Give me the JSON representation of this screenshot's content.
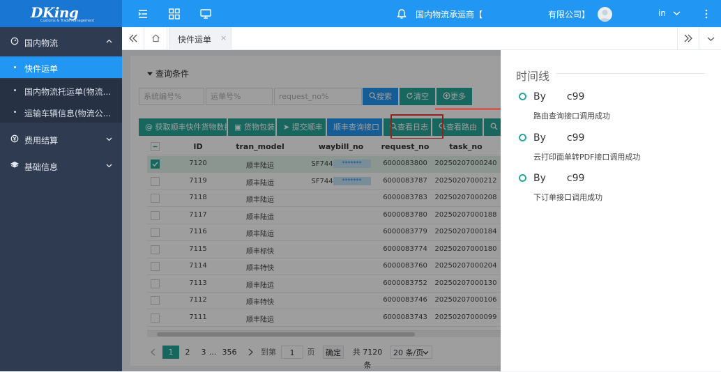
{
  "header": {
    "logo": "DKing",
    "logo_subtitle": "Customs & Trade Management",
    "company_left": "国内物流承运商【",
    "company_right": "有限公司】",
    "lang": "in"
  },
  "sidebar": {
    "groups": [
      {
        "label": "国内物流"
      },
      {
        "label": "费用结算"
      },
      {
        "label": "基础信息"
      }
    ],
    "items": [
      {
        "label": "快件运单"
      },
      {
        "label": "国内物流托运单(物流..."
      },
      {
        "label": "运输车辆信息(物流公..."
      }
    ]
  },
  "tabs": {
    "active_label": "快件运单",
    "close_glyph": "×"
  },
  "query": {
    "title": "查询条件",
    "inputs": [
      {
        "placeholder": "系统编号%"
      },
      {
        "placeholder": "运单号%"
      },
      {
        "placeholder": "request_no%"
      }
    ],
    "buttons": {
      "search": "搜索",
      "clear": "清空",
      "more": "更多"
    }
  },
  "toolbar": {
    "get_data": "获取顺丰快件货物数据",
    "package": "货物包装",
    "submit_sf": "提交顺丰",
    "sf_query_api": "顺丰查询接口",
    "view_log": "查看日志",
    "view_route": "查看路由"
  },
  "table": {
    "columns": [
      "ID",
      "tran_model",
      "waybill_no",
      "request_no",
      "task_no"
    ],
    "rows": [
      {
        "id": "7120",
        "tran_model": "顺丰陆运",
        "waybill_prefix": "SF744",
        "waybill_mask": "*******",
        "request_no": "6000083800",
        "task_no": "20250207000240",
        "selected": true
      },
      {
        "id": "7119",
        "tran_model": "顺丰陆运",
        "waybill_prefix": "SF744",
        "waybill_mask": "*******",
        "request_no": "6000083787",
        "task_no": "20250207000212",
        "selected": false
      },
      {
        "id": "7118",
        "tran_model": "顺丰陆运",
        "waybill_prefix": "",
        "waybill_mask": "",
        "request_no": "6000083783",
        "task_no": "20250207000208",
        "selected": false
      },
      {
        "id": "7117",
        "tran_model": "顺丰陆运",
        "waybill_prefix": "",
        "waybill_mask": "",
        "request_no": "6000083780",
        "task_no": "20250207000188",
        "selected": false
      },
      {
        "id": "7116",
        "tran_model": "顺丰陆运",
        "waybill_prefix": "",
        "waybill_mask": "",
        "request_no": "6000083779",
        "task_no": "20250207000184",
        "selected": false
      },
      {
        "id": "7115",
        "tran_model": "顺丰标快",
        "waybill_prefix": "",
        "waybill_mask": "",
        "request_no": "6000083774",
        "task_no": "20250207000180",
        "selected": false
      },
      {
        "id": "7114",
        "tran_model": "顺丰特快",
        "waybill_prefix": "",
        "waybill_mask": "",
        "request_no": "6000083760",
        "task_no": "20250207000204",
        "selected": false
      },
      {
        "id": "7113",
        "tran_model": "顺丰陆运",
        "waybill_prefix": "",
        "waybill_mask": "",
        "request_no": "6000083752",
        "task_no": "20250207000130",
        "selected": false
      },
      {
        "id": "7112",
        "tran_model": "顺丰特快",
        "waybill_prefix": "",
        "waybill_mask": "",
        "request_no": "6000083746",
        "task_no": "20250207000106",
        "selected": false
      },
      {
        "id": "7111",
        "tran_model": "顺丰陆运",
        "waybill_prefix": "",
        "waybill_mask": "",
        "request_no": "6000083743",
        "task_no": "20250207000099",
        "selected": false
      }
    ]
  },
  "pager": {
    "pages": [
      "1",
      "2",
      "3",
      "...",
      "356"
    ],
    "goto_label": "到第",
    "goto_value": "1",
    "page_unit": "页",
    "confirm": "确定",
    "total": "共 7120 条",
    "page_size": "20 条/页"
  },
  "timeline": {
    "title": "时间线",
    "entries": [
      {
        "by": "By",
        "user": "c99",
        "desc": "路由查询接口调用成功"
      },
      {
        "by": "By",
        "user": "c99",
        "desc": "云打印面单转PDF接口调用成功"
      },
      {
        "by": "By",
        "user": "c99",
        "desc": "下订单接口调用成功"
      }
    ]
  },
  "colors": {
    "primary": "#2196f3",
    "teal": "#26a69a",
    "sidebar": "#2e3b50",
    "highlight": "#e53935"
  }
}
